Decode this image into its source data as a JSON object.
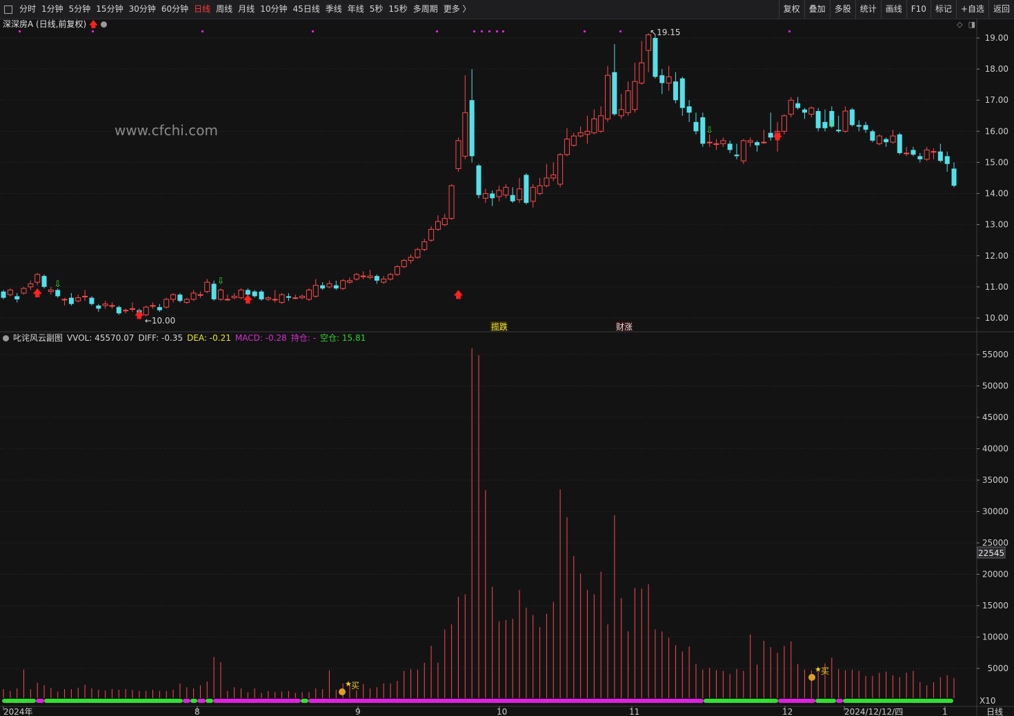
{
  "toolbar": {
    "periods": [
      "分时",
      "1分钟",
      "5分钟",
      "15分钟",
      "30分钟",
      "60分钟",
      "日线",
      "周线",
      "月线",
      "10分钟",
      "45日线",
      "季线",
      "年线",
      "5秒",
      "15秒",
      "多周期",
      "更多 〉"
    ],
    "active_period": "日线",
    "right_items": [
      "复权",
      "叠加",
      "多股",
      "统计",
      "画线",
      "F10",
      "标记",
      "+自选",
      "返回"
    ]
  },
  "main_chart": {
    "title": "深深房A (日线,前复权)",
    "watermark": "www.cfchi.com",
    "high_label": "19.15",
    "low_label": "10.00",
    "y_ticks": [
      "19.00",
      "18.00",
      "17.00",
      "16.00",
      "15.00",
      "14.00",
      "13.00",
      "12.00",
      "11.00",
      "10.00"
    ],
    "tags": [
      {
        "text": "揽跌",
        "x_index": "up"
      },
      {
        "text": "财涨",
        "x_index": "mid"
      }
    ]
  },
  "sub_chart": {
    "title": "叱诧风云副图",
    "vvol_label": "VVOL:",
    "vvol_value": "45570.07",
    "diff_label": "DIFF:",
    "diff_value": "-0.35",
    "dea_label": "DEA:",
    "dea_value": "-0.21",
    "macd_label": "MACD:",
    "macd_value": "-0.28",
    "hold_label": "持仓:",
    "hold_value": "-",
    "empty_label": "空仓:",
    "empty_value": "15.81",
    "y_ticks": [
      "55000",
      "50000",
      "45000",
      "40000",
      "35000",
      "30000",
      "25000",
      "20000",
      "15000",
      "10000",
      "5000"
    ],
    "current_value": "22545",
    "multiplier": "X10",
    "buy_label": "买",
    "colors": {
      "vvol": "#d0d0d0",
      "diff": "#d0d0d0",
      "dea": "#e8e830",
      "macd": "#d030d0",
      "hold": "#d030d0",
      "empty": "#30d030"
    }
  },
  "x_axis": {
    "labels": [
      "2024年",
      "8",
      "9",
      "10",
      "11",
      "12",
      "2024/12/12/四",
      "1"
    ],
    "period_label": "日线"
  },
  "chart_data": {
    "type": "candlestick",
    "series_colors": {
      "up": "#ff4b4b",
      "down": "#54e0e8"
    },
    "candles": [
      [
        10.85,
        10.65,
        10.9,
        10.6
      ],
      [
        10.75,
        10.9,
        10.95,
        10.7
      ],
      [
        10.7,
        10.6,
        10.8,
        10.5
      ],
      [
        10.8,
        10.95,
        11.0,
        10.75
      ],
      [
        11.0,
        11.1,
        11.2,
        10.9
      ],
      [
        11.15,
        11.4,
        11.45,
        11.05
      ],
      [
        11.35,
        11.0,
        11.4,
        10.95
      ],
      [
        10.85,
        10.9,
        11.0,
        10.75
      ],
      [
        10.9,
        10.7,
        10.95,
        10.65
      ],
      [
        10.6,
        10.6,
        10.65,
        10.4
      ],
      [
        10.65,
        10.45,
        10.8,
        10.4
      ],
      [
        10.55,
        10.65,
        10.75,
        10.5
      ],
      [
        10.7,
        10.7,
        10.9,
        10.55
      ],
      [
        10.65,
        10.45,
        10.7,
        10.4
      ],
      [
        10.4,
        10.3,
        10.45,
        10.2
      ],
      [
        10.4,
        10.45,
        10.55,
        10.3
      ],
      [
        10.4,
        10.4,
        10.5,
        10.3
      ],
      [
        10.35,
        10.15,
        10.4,
        10.1
      ],
      [
        10.25,
        10.25,
        10.3,
        10.15
      ],
      [
        10.3,
        10.3,
        10.5,
        10.2
      ],
      [
        10.25,
        10.05,
        10.3,
        10.0
      ],
      [
        10.1,
        10.35,
        10.4,
        10.05
      ],
      [
        10.4,
        10.4,
        10.5,
        10.3
      ],
      [
        10.35,
        10.25,
        10.45,
        10.2
      ],
      [
        10.35,
        10.6,
        10.65,
        10.3
      ],
      [
        10.6,
        10.75,
        10.8,
        10.5
      ],
      [
        10.75,
        10.55,
        10.8,
        10.5
      ],
      [
        10.5,
        10.6,
        10.65,
        10.45
      ],
      [
        10.6,
        10.8,
        10.9,
        10.55
      ],
      [
        10.75,
        10.75,
        10.85,
        10.65
      ],
      [
        10.85,
        11.15,
        11.25,
        10.8
      ],
      [
        11.1,
        10.6,
        11.2,
        10.55
      ],
      [
        10.6,
        10.9,
        10.95,
        10.55
      ],
      [
        10.6,
        10.6,
        10.75,
        10.55
      ],
      [
        10.65,
        10.7,
        10.8,
        10.6
      ],
      [
        10.65,
        10.9,
        10.95,
        10.6
      ],
      [
        10.9,
        10.75,
        10.95,
        10.7
      ],
      [
        10.85,
        10.7,
        10.9,
        10.65
      ],
      [
        10.85,
        10.6,
        10.9,
        10.55
      ],
      [
        10.6,
        10.65,
        10.7,
        10.55
      ],
      [
        10.6,
        10.6,
        10.9,
        10.5
      ],
      [
        10.5,
        10.75,
        10.8,
        10.45
      ],
      [
        10.7,
        10.65,
        10.8,
        10.55
      ],
      [
        10.65,
        10.65,
        10.75,
        10.6
      ],
      [
        10.65,
        10.7,
        10.75,
        10.6
      ],
      [
        10.6,
        10.9,
        10.95,
        10.55
      ],
      [
        10.7,
        11.05,
        11.25,
        10.65
      ],
      [
        11.05,
        10.95,
        11.15,
        10.9
      ],
      [
        11.0,
        11.1,
        11.2,
        10.95
      ],
      [
        11.05,
        10.95,
        11.2,
        10.9
      ],
      [
        10.95,
        11.2,
        11.25,
        10.9
      ],
      [
        11.15,
        11.2,
        11.3,
        11.1
      ],
      [
        11.25,
        11.4,
        11.45,
        11.2
      ],
      [
        11.35,
        11.35,
        11.5,
        11.25
      ],
      [
        11.3,
        11.35,
        11.55,
        11.25
      ],
      [
        11.35,
        11.2,
        11.4,
        11.1
      ],
      [
        11.15,
        11.25,
        11.35,
        11.1
      ],
      [
        11.25,
        11.4,
        11.45,
        11.2
      ],
      [
        11.4,
        11.65,
        11.7,
        11.35
      ],
      [
        11.65,
        11.85,
        11.9,
        11.6
      ],
      [
        11.85,
        11.95,
        12.05,
        11.75
      ],
      [
        11.95,
        12.2,
        12.25,
        11.9
      ],
      [
        12.2,
        12.45,
        12.55,
        12.15
      ],
      [
        12.5,
        12.85,
        12.95,
        12.45
      ],
      [
        12.85,
        13.1,
        13.3,
        12.8
      ],
      [
        13.0,
        13.2,
        13.35,
        12.95
      ],
      [
        13.2,
        14.25,
        14.3,
        13.15
      ],
      [
        14.8,
        15.7,
        15.8,
        14.7
      ],
      [
        15.2,
        16.6,
        17.8,
        15.1
      ],
      [
        17.0,
        15.2,
        18.0,
        15.0
      ],
      [
        14.9,
        13.95,
        14.95,
        13.85
      ],
      [
        13.85,
        14.0,
        14.15,
        13.7
      ],
      [
        14.0,
        13.85,
        14.1,
        13.6
      ],
      [
        13.9,
        14.1,
        14.25,
        13.75
      ],
      [
        13.95,
        14.2,
        14.3,
        13.85
      ],
      [
        13.95,
        13.75,
        14.2,
        13.7
      ],
      [
        13.8,
        14.15,
        14.5,
        13.7
      ],
      [
        14.6,
        13.7,
        14.65,
        13.65
      ],
      [
        13.75,
        14.2,
        14.3,
        13.55
      ],
      [
        14.0,
        14.25,
        14.5,
        13.95
      ],
      [
        14.25,
        14.5,
        14.95,
        14.2
      ],
      [
        14.5,
        14.6,
        15.0,
        14.4
      ],
      [
        14.3,
        15.25,
        15.3,
        14.2
      ],
      [
        15.25,
        15.75,
        16.1,
        15.2
      ],
      [
        15.55,
        15.85,
        15.95,
        15.5
      ],
      [
        15.85,
        15.95,
        16.15,
        15.8
      ],
      [
        15.9,
        16.0,
        16.5,
        15.6
      ],
      [
        15.95,
        16.4,
        16.7,
        15.9
      ],
      [
        16.0,
        16.5,
        16.8,
        15.95
      ],
      [
        16.4,
        17.8,
        18.1,
        16.3
      ],
      [
        17.9,
        16.55,
        18.8,
        16.5
      ],
      [
        16.5,
        16.7,
        17.2,
        16.4
      ],
      [
        16.6,
        17.3,
        17.6,
        16.5
      ],
      [
        16.7,
        17.6,
        18.2,
        16.6
      ],
      [
        17.55,
        18.2,
        18.9,
        17.5
      ],
      [
        18.6,
        19.1,
        19.15,
        17.9
      ],
      [
        19.0,
        17.75,
        19.1,
        17.7
      ],
      [
        17.8,
        17.55,
        18.0,
        17.2
      ],
      [
        17.55,
        17.75,
        18.1,
        17.3
      ],
      [
        17.6,
        17.0,
        17.9,
        16.9
      ],
      [
        17.7,
        16.75,
        17.75,
        16.5
      ],
      [
        16.8,
        16.6,
        17.0,
        16.3
      ],
      [
        16.3,
        16.0,
        16.6,
        15.9
      ],
      [
        16.45,
        15.6,
        16.6,
        15.5
      ],
      [
        15.65,
        15.65,
        15.9,
        15.5
      ],
      [
        15.6,
        15.6,
        15.75,
        15.4
      ],
      [
        15.6,
        15.7,
        15.8,
        15.5
      ],
      [
        15.6,
        15.4,
        15.7,
        15.3
      ],
      [
        15.25,
        15.2,
        15.6,
        15.1
      ],
      [
        15.05,
        15.7,
        15.75,
        14.95
      ],
      [
        15.65,
        15.7,
        15.8,
        15.5
      ],
      [
        15.65,
        15.55,
        15.7,
        15.35
      ],
      [
        15.65,
        15.65,
        16.05,
        15.6
      ],
      [
        15.95,
        15.8,
        16.6,
        15.7
      ],
      [
        15.8,
        16.0,
        16.3,
        15.35
      ],
      [
        16.0,
        16.5,
        16.55,
        15.9
      ],
      [
        16.55,
        17.0,
        17.1,
        16.45
      ],
      [
        16.9,
        16.75,
        17.1,
        16.7
      ],
      [
        16.7,
        16.6,
        16.75,
        16.4
      ],
      [
        16.55,
        16.75,
        16.8,
        16.45
      ],
      [
        16.65,
        16.1,
        16.75,
        16.0
      ],
      [
        16.3,
        16.1,
        16.7,
        16.0
      ],
      [
        16.65,
        16.15,
        16.8,
        16.1
      ],
      [
        16.05,
        16.0,
        16.5,
        15.95
      ],
      [
        16.0,
        16.65,
        16.8,
        15.95
      ],
      [
        16.7,
        16.2,
        16.75,
        16.15
      ],
      [
        16.2,
        16.15,
        16.35,
        16.0
      ],
      [
        16.2,
        16.05,
        16.3,
        15.95
      ],
      [
        16.0,
        15.7,
        16.05,
        15.65
      ],
      [
        15.6,
        15.85,
        15.9,
        15.55
      ],
      [
        15.75,
        15.65,
        15.8,
        15.5
      ],
      [
        15.65,
        15.85,
        16.05,
        15.6
      ],
      [
        15.9,
        15.3,
        15.95,
        15.25
      ],
      [
        15.3,
        15.3,
        15.5,
        15.2
      ],
      [
        15.4,
        15.25,
        15.5,
        15.2
      ],
      [
        15.2,
        15.1,
        15.3,
        15.0
      ],
      [
        15.1,
        15.4,
        15.5,
        15.05
      ],
      [
        15.35,
        15.35,
        15.45,
        15.1
      ],
      [
        15.35,
        15.05,
        15.6,
        15.0
      ],
      [
        15.2,
        14.95,
        15.35,
        14.7
      ],
      [
        14.8,
        14.25,
        15.0,
        14.2
      ]
    ],
    "volumes": [
      1700,
      1400,
      1800,
      4800,
      1700,
      2700,
      2300,
      1900,
      1300,
      1700,
      1700,
      1900,
      2400,
      1800,
      1600,
      1500,
      1700,
      1600,
      1700,
      1600,
      1400,
      1400,
      1600,
      1400,
      1400,
      1600,
      2600,
      2000,
      1800,
      2300,
      2900,
      6800,
      6000,
      1400,
      2000,
      1800,
      1200,
      1800,
      1100,
      1400,
      1200,
      1300,
      1400,
      1100,
      1200,
      1200,
      1800,
      1700,
      4700,
      1600,
      2600,
      2500,
      1500,
      2500,
      1800,
      2000,
      2600,
      2600,
      3000,
      4600,
      4900,
      4800,
      5900,
      8600,
      5900,
      11200,
      12000,
      16400,
      16800,
      56000,
      54900,
      33400,
      18000,
      12500,
      12700,
      12900,
      17500,
      14700,
      13500,
      11600,
      13700,
      15600,
      33500,
      29100,
      22900,
      20100,
      17500,
      16800,
      20400,
      12000,
      29400,
      16200,
      10900,
      17800,
      17700,
      18400,
      11200,
      10900,
      9900,
      8700,
      7700,
      8500,
      5700,
      4800,
      5100,
      4700,
      4600,
      4100,
      4900,
      4600,
      10400,
      5600,
      9400,
      8400,
      7500,
      8600,
      9300,
      5700,
      4800,
      4700,
      4500,
      5800,
      6700,
      4900,
      4700,
      4800,
      4600,
      3800,
      3800,
      4300,
      4500,
      3900,
      3600,
      4300,
      4600,
      2800,
      2300,
      2800,
      3600,
      3900,
      3500,
      5300,
      5900
    ]
  }
}
